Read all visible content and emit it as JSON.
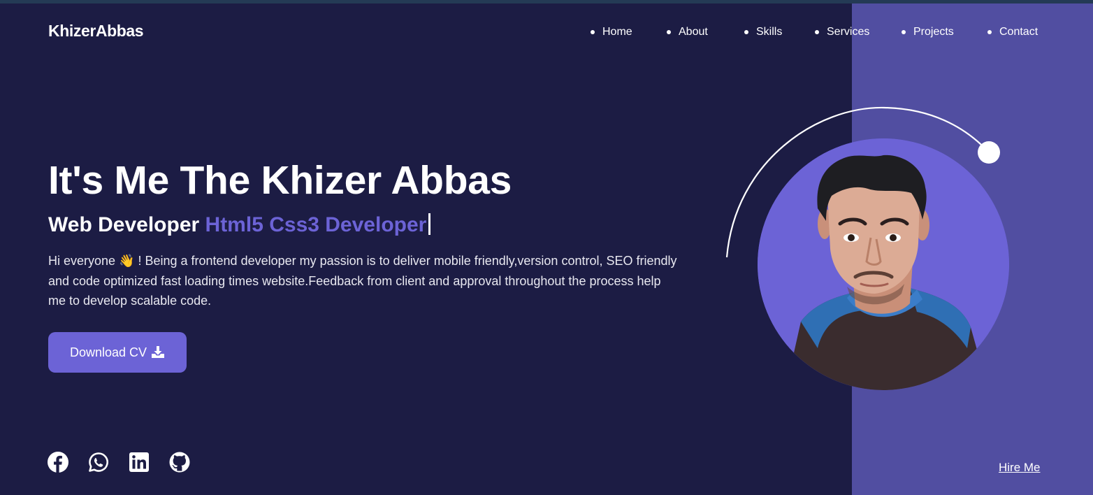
{
  "brand": {
    "logo_text": "KhizerAbbas"
  },
  "nav": {
    "items": [
      {
        "label": "Home"
      },
      {
        "label": "About"
      },
      {
        "label": "Skills"
      },
      {
        "label": "Services"
      },
      {
        "label": "Projects"
      },
      {
        "label": "Contact"
      }
    ]
  },
  "hero": {
    "headline": "It's Me The Khizer Abbas",
    "role_prefix": "Web Developer ",
    "role_typed": "Html5 Css3 Developer",
    "bio": "Hi everyone 👋 ! Being a frontend developer my passion is to deliver mobile friendly,version control, SEO friendly and code optimized fast loading times website.Feedback from client and approval throughout the process help me to develop scalable code.",
    "cv_button_label": "Download CV",
    "cv_button_icon": "download-icon"
  },
  "socials": [
    {
      "name": "facebook-icon"
    },
    {
      "name": "whatsapp-icon"
    },
    {
      "name": "linkedin-icon"
    },
    {
      "name": "github-icon"
    }
  ],
  "hire_me_label": "Hire Me",
  "profile": {
    "image": "profile-photo"
  },
  "colors": {
    "background": "#1c1c44",
    "accent": "#6c63d6",
    "panel": "#514ea1",
    "text": "#ffffff"
  }
}
